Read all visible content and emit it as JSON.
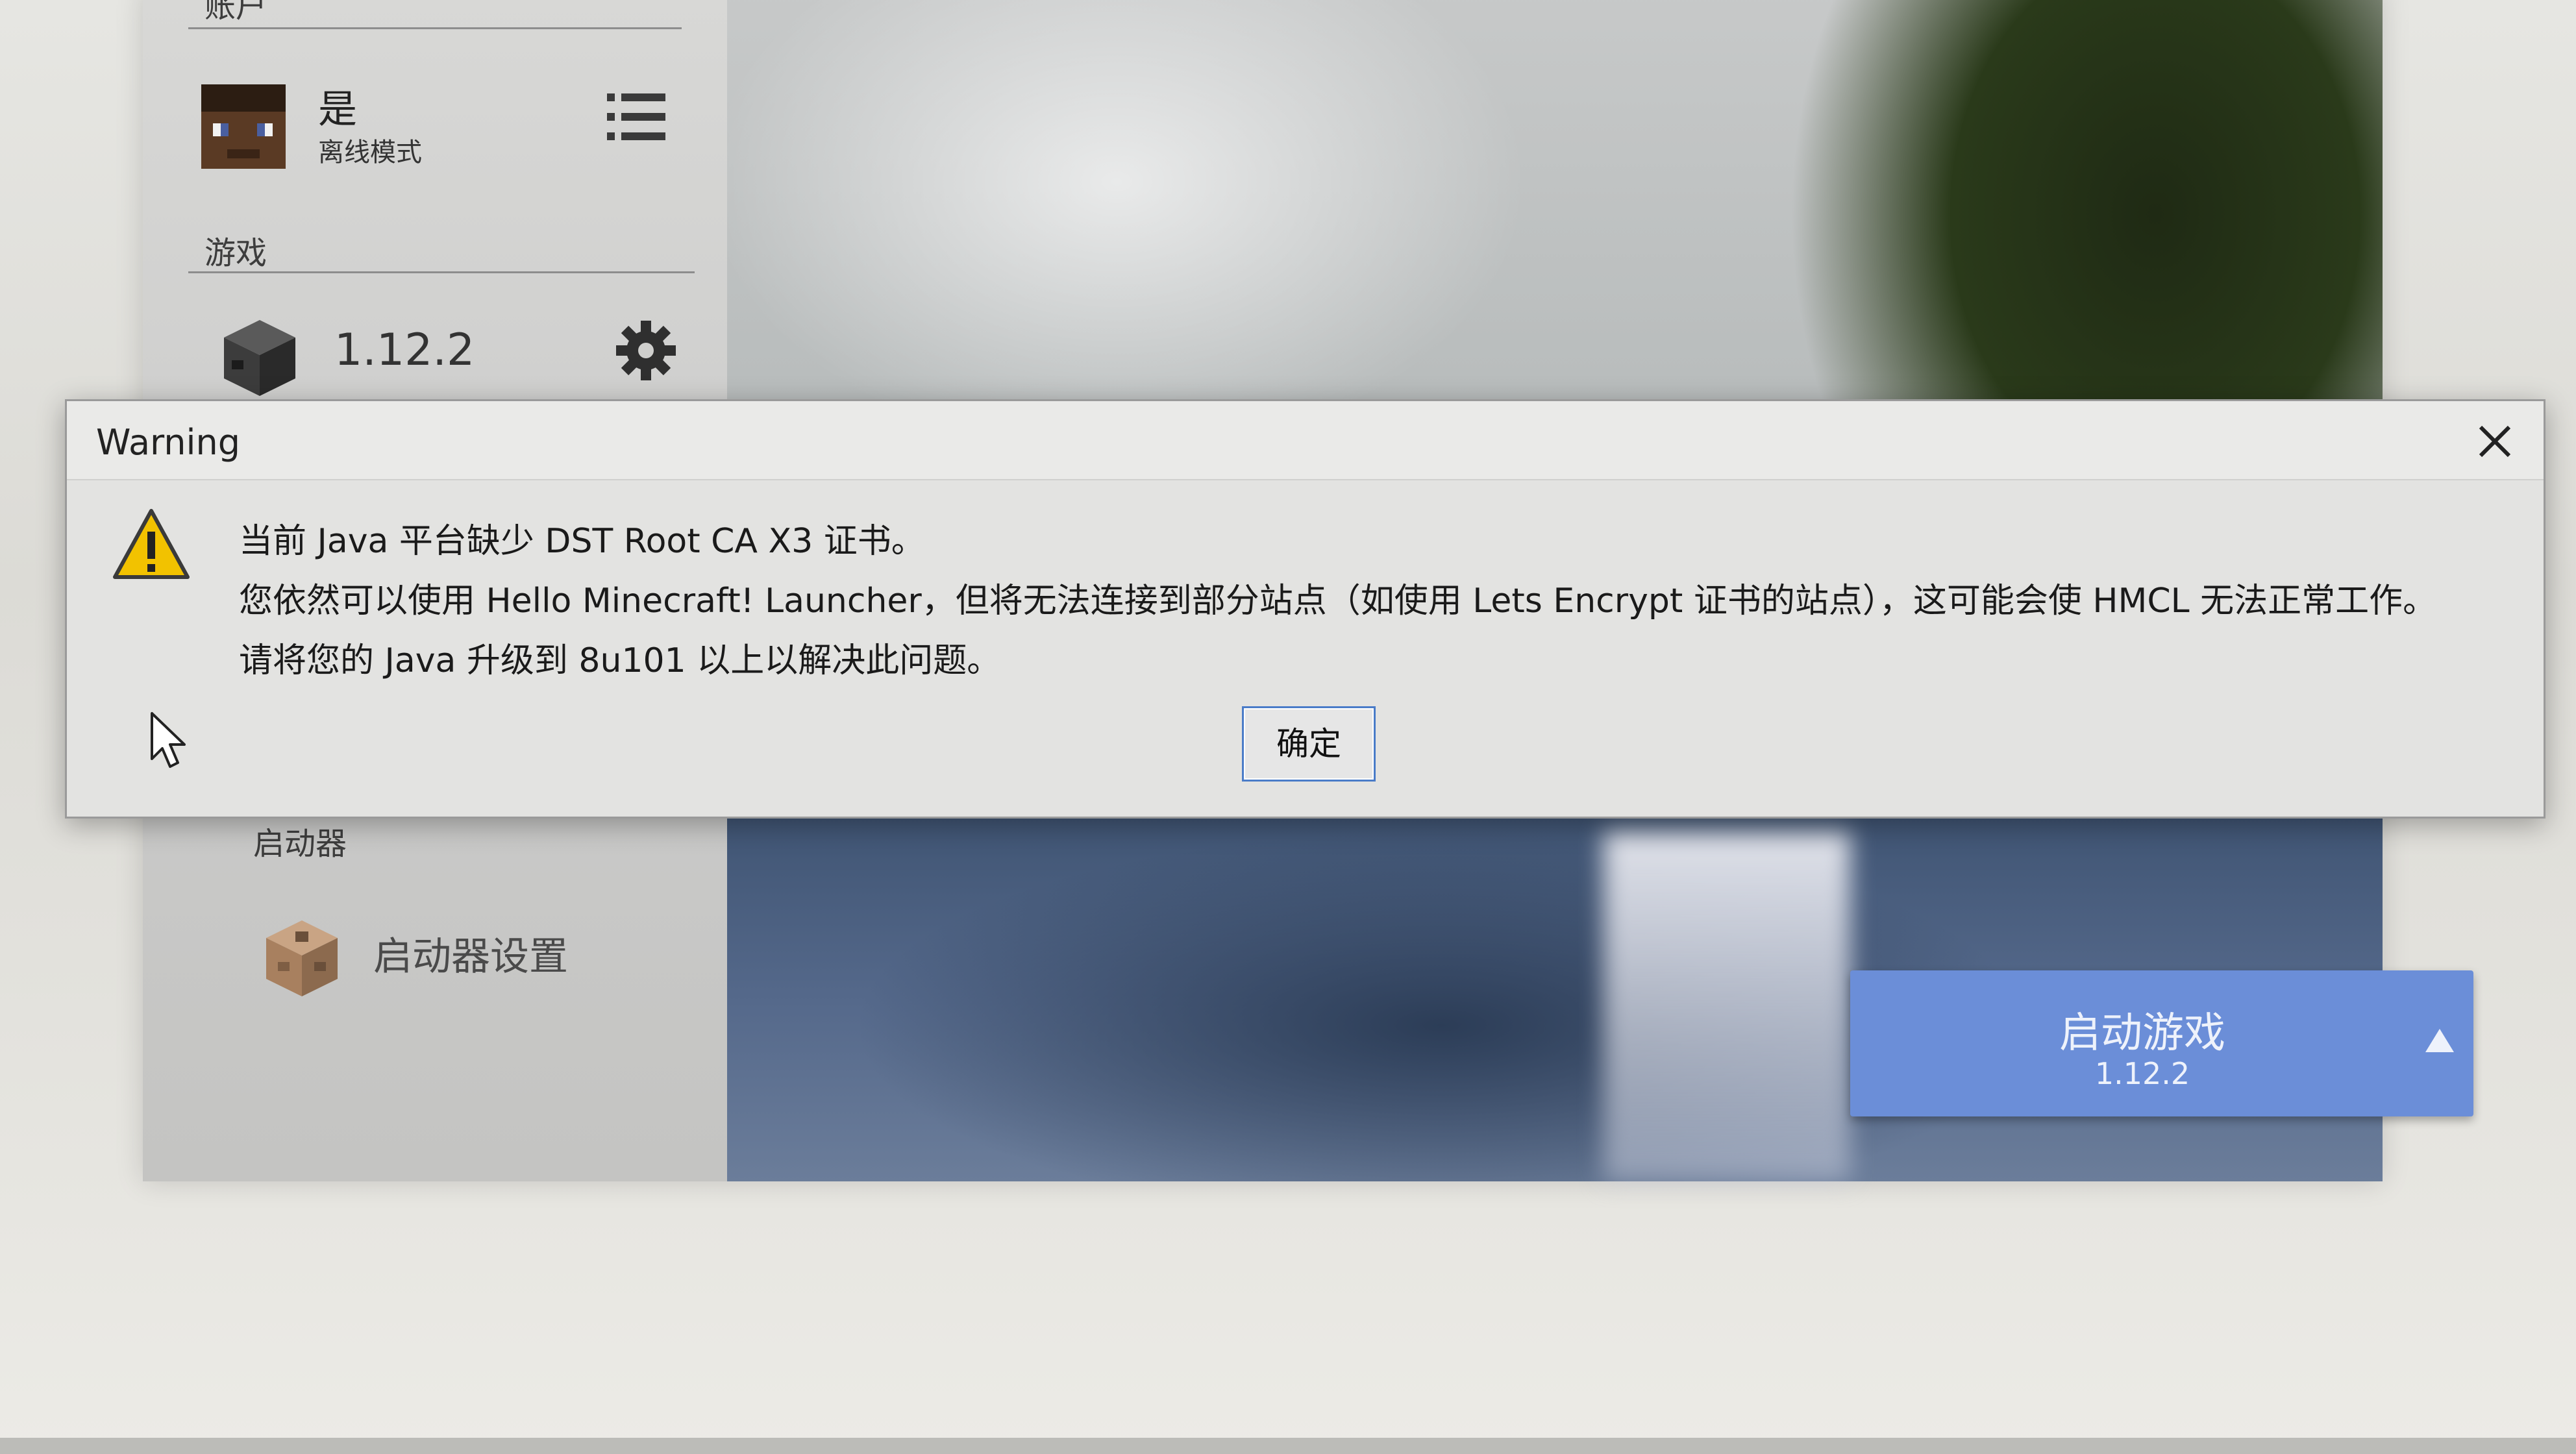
{
  "account": {
    "section_label": "账户",
    "username": "是",
    "mode": "离线模式"
  },
  "game": {
    "section_label": "游戏",
    "version": "1.12.2"
  },
  "launcher": {
    "section_label": "启动器",
    "settings_label": "启动器设置"
  },
  "launch_button": {
    "title": "启动游戏",
    "version": "1.12.2"
  },
  "dialog": {
    "title": "Warning",
    "lines": [
      "当前 Java 平台缺少 DST Root CA X3 证书。",
      "您依然可以使用 Hello Minecraft! Launcher，但将无法连接到部分站点（如使用 Lets Encrypt 证书的站点），这可能会使 HMCL 无法正常工作。",
      "请将您的 Java 升级到 8u101 以上以解决此问题。"
    ],
    "ok_label": "确定"
  },
  "colors": {
    "accent": "#6b8ed8",
    "focus_border": "#4a7cc8",
    "warning_yellow": "#f2c200"
  },
  "icons": {
    "menu": "menu-icon",
    "settings": "gear-icon",
    "close": "close-icon",
    "warning": "warning-icon",
    "cursor": "cursor-icon",
    "launch_arrow": "chevron-up-icon"
  }
}
